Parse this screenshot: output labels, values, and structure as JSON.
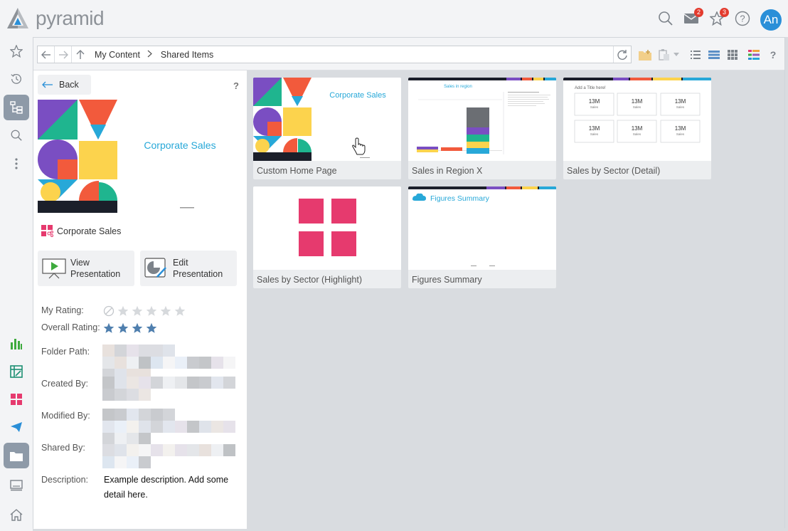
{
  "app": {
    "name": "pyramid"
  },
  "topbar": {
    "mail_badge": "2",
    "alerts_badge": "3",
    "avatar_initials": "An"
  },
  "breadcrumb": {
    "root": "My Content",
    "current": "Shared Items"
  },
  "panel": {
    "back_label": "Back",
    "help_label": "?",
    "thumbnail_title": "Corporate Sales",
    "item_name": "Corporate Sales",
    "view_label_1": "View",
    "view_label_2": "Presentation",
    "edit_label_1": "Edit",
    "edit_label_2": "Presentation",
    "my_rating_label": "My Rating:",
    "my_rating": 0,
    "overall_rating_label": "Overall Rating:",
    "overall_rating": 4,
    "folder_path_label": "Folder Path:",
    "created_by_label": "Created By:",
    "modified_by_label": "Modified By:",
    "shared_by_label": "Shared By:",
    "description_label": "Description:",
    "description": "Example description. Add some detail here."
  },
  "cards": [
    {
      "caption": "Custom Home Page",
      "thumb_title": "Corporate Sales"
    },
    {
      "caption": "Sales in Region X",
      "thumb_title": "Sales in region"
    },
    {
      "caption": "Sales by Sector (Detail)",
      "thumb_title": "Add a Title here!",
      "kpi": "13M",
      "kpi_sub": "Sales"
    },
    {
      "caption": "Sales by Sector (Highlight)"
    },
    {
      "caption": "Figures Summary",
      "thumb_title": "Figures Summary"
    }
  ],
  "colors": {
    "accent": "#2a8fd8",
    "title_cyan": "#27a8d8",
    "star_filled": "#4f7fae",
    "star_empty": "#d6d9dc",
    "badge": "#e33b2e",
    "pink": "#e63a6e"
  },
  "icons": {
    "rail": [
      "star-icon",
      "history-icon",
      "content-tree-icon",
      "search-icon",
      "more-icon",
      "discover-icon",
      "formulate-icon",
      "present-icon",
      "publish-icon",
      "content-icon",
      "browser-icon",
      "home-icon"
    ],
    "toolbar": [
      "new-folder-icon",
      "paste-icon",
      "list-view-icon",
      "detail-view-icon",
      "grid-view-icon",
      "color-icon",
      "help-icon"
    ]
  }
}
